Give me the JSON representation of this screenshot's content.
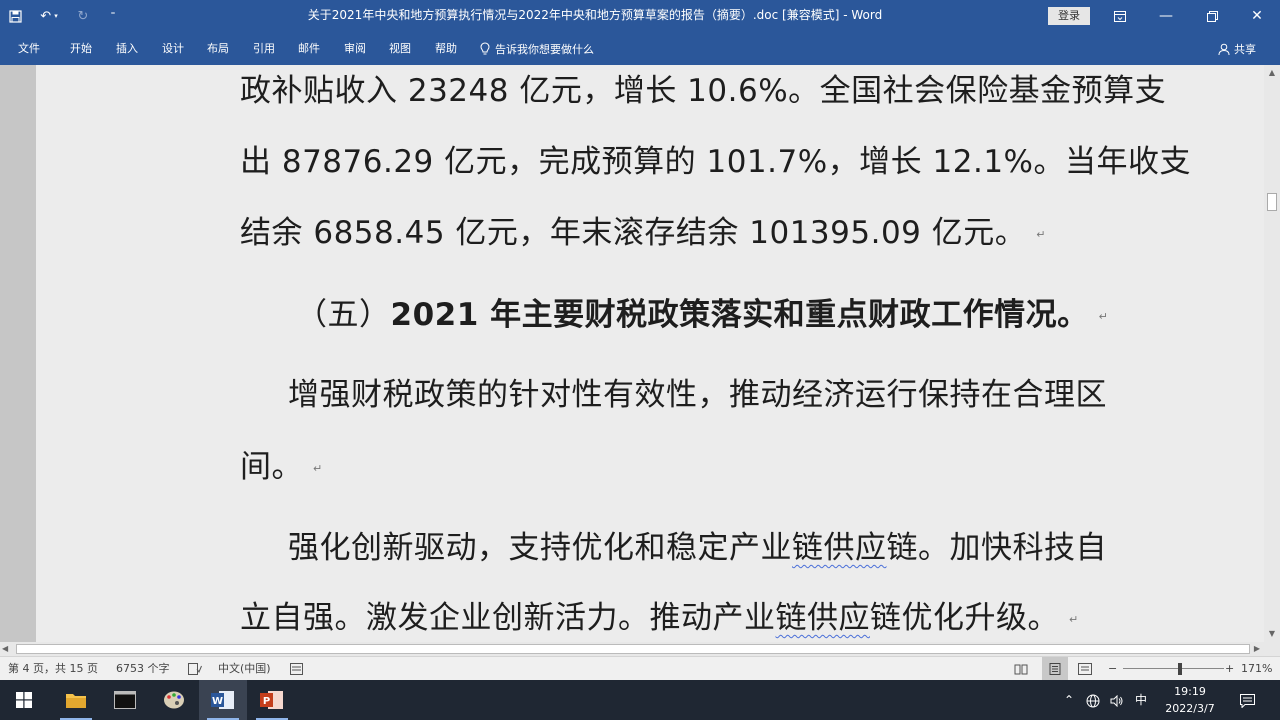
{
  "title_bar": {
    "doc_title": "关于2021年中央和地方预算执行情况与2022年中央和地方预算草案的报告（摘要）.doc [兼容模式]  -  Word",
    "login_label": "登录"
  },
  "ribbon": {
    "tabs": [
      "文件",
      "开始",
      "插入",
      "设计",
      "布局",
      "引用",
      "邮件",
      "审阅",
      "视图",
      "帮助"
    ],
    "tell_me": "告诉我你想要做什么",
    "share": "共享"
  },
  "document": {
    "lines": {
      "l1": "政补贴收入 23248 亿元，增长 10.6%。全国社会保险基金预算支",
      "l2": "出 87876.29 亿元，完成预算的 101.7%，增长 12.1%。当年收支",
      "l3": "结余 6858.45 亿元，年末滚存结余 101395.09 亿元。",
      "heading_prefix": "（五）",
      "heading_rest": "2021 年主要财税政策落实和重点财政工作情况。",
      "p1_l1": "增强财税政策的针对性有效性，推动经济运行保持在合理区",
      "p1_l2": "间。",
      "p2_l1_a": "强化创新驱动，支持优化和稳定产业",
      "p2_l1_b": "链供应",
      "p2_l1_c": "链。加快科技自",
      "p2_l2_a": "立自强。激发企业创新活力。推动产业",
      "p2_l2_b": "链供应",
      "p2_l2_c": "链优化升级。"
    },
    "paragraph_mark": "↵"
  },
  "status_bar": {
    "page": "第 4 页，共 15 页",
    "words": "6753 个字",
    "language": "中文(中国)",
    "zoom": "171%",
    "zoom_level_percent": 171
  },
  "taskbar": {
    "ime": "中",
    "time": "19:19",
    "date": "2022/3/7"
  },
  "colors": {
    "accent": "#2b579a",
    "page": "#ececec",
    "taskbar": "#1f2733"
  }
}
